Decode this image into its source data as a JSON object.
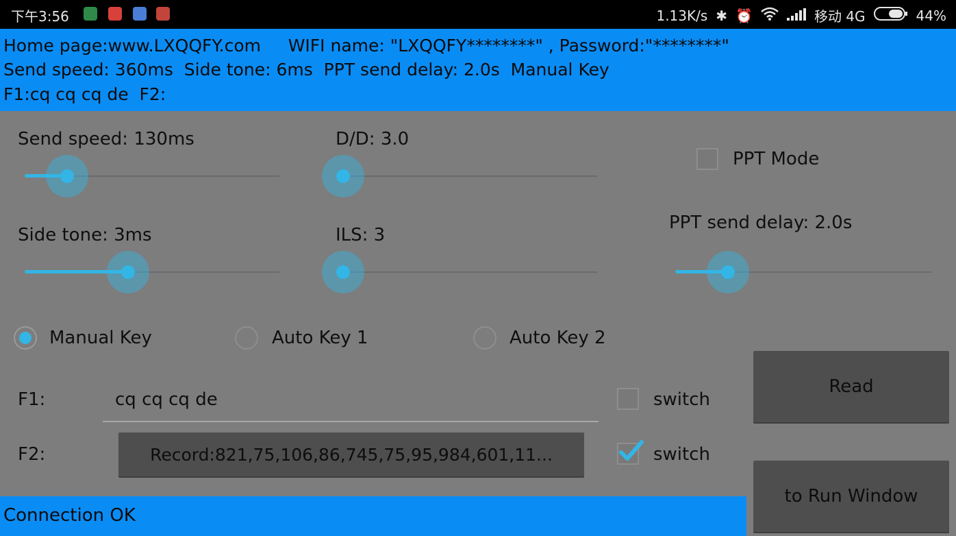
{
  "statusbar": {
    "time": "下午3:56",
    "net_speed": "1.13K/s",
    "carrier": "移动 4G",
    "battery": "44%",
    "icons": [
      "shield-app-icon",
      "weibo-app-icon",
      "chat-app-icon",
      "wifi-app-icon",
      "bluetooth-icon",
      "alarm-icon",
      "wifi-icon",
      "signal-icon",
      "battery-icon"
    ]
  },
  "banner": {
    "line1": "Home page:www.LXQQFY.com     WIFI name: \"LXQQFY********\" , Password:\"********\"",
    "line2": "Send speed: 360ms  Side tone: 6ms  PPT send delay: 2.0s  Manual Key",
    "line3": "F1:cq cq cq de  F2:"
  },
  "sliders": {
    "send_speed": {
      "label": "Send speed: 130ms",
      "fraction": 0.16
    },
    "dd": {
      "label": "D/D: 3.0",
      "fraction": 0.0
    },
    "side_tone": {
      "label": "Side tone: 3ms",
      "fraction": 0.4
    },
    "ils": {
      "label": "ILS: 3",
      "fraction": 0.0
    },
    "ppt_delay": {
      "label": "PPT send delay: 2.0s",
      "fraction": 0.2
    }
  },
  "ppt_mode": {
    "label": "PPT Mode",
    "checked": false
  },
  "key_mode": {
    "options": [
      "Manual Key",
      "Auto Key 1",
      "Auto Key 2"
    ],
    "selected": "Manual Key"
  },
  "f1": {
    "label": "F1:",
    "value": "cq cq cq de",
    "switch_label": "switch",
    "switch_checked": false
  },
  "f2": {
    "label": "F2:",
    "button": "Record:821,75,106,86,745,75,95,984,601,11...",
    "switch_label": "switch",
    "switch_checked": true
  },
  "buttons": {
    "read": "Read",
    "run_window": "to Run Window"
  },
  "status": {
    "text": "Connection OK"
  },
  "colors": {
    "accent": "#33b5e5",
    "banner": "#0a8cf5",
    "background": "#7d7d7d",
    "button": "#4e4e4e"
  }
}
